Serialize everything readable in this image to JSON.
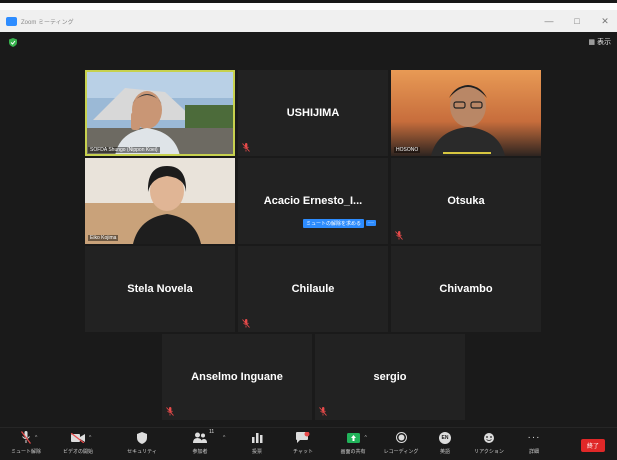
{
  "window": {
    "title": "Zoom ミーティング",
    "controls": [
      "—",
      "□",
      "✕"
    ]
  },
  "top": {
    "view_label": "表示",
    "view_icon": "grid-icon",
    "security_icon": "shield-icon"
  },
  "colors": {
    "background": "#1a1a1a",
    "tile": "#222222",
    "active_speaker_border": "#c7d14e",
    "accent": "#2d8cff",
    "end_button": "#e02828",
    "muted_icon": "#e84a4a"
  },
  "participants": [
    {
      "tile_label": "",
      "name_tag": "SOFDA Shungo (Nippon Koei)",
      "video": true,
      "active_speaker": true,
      "muted": false
    },
    {
      "tile_label": "USHIJIMA",
      "name_tag": "",
      "video": false,
      "muted": true
    },
    {
      "tile_label": "",
      "name_tag": "HOSONO",
      "video": true,
      "muted": false
    },
    {
      "tile_label": "",
      "name_tag": "Eiko Kojima",
      "video": true,
      "muted": false
    },
    {
      "tile_label": "Acacio  Ernesto_I...",
      "name_tag": "",
      "video": false,
      "muted": false
    },
    {
      "tile_label": "Otsuka",
      "name_tag": "",
      "video": false,
      "muted": true
    },
    {
      "tile_label": "Stela Novela",
      "name_tag": "",
      "video": false,
      "muted": false
    },
    {
      "tile_label": "Chilaule",
      "name_tag": "",
      "video": false,
      "muted": true
    },
    {
      "tile_label": "Chivambo",
      "name_tag": "",
      "video": false,
      "muted": false
    },
    {
      "tile_label": "Anselmo Inguane",
      "name_tag": "",
      "video": false,
      "muted": true
    },
    {
      "tile_label": "sergio",
      "name_tag": "",
      "video": false,
      "muted": true
    }
  ],
  "unmute_request": {
    "label": "ミュートの解除を求める",
    "more": "···"
  },
  "toolbar": {
    "items": [
      {
        "label": "ミュート解除",
        "icon": "microphone-muted-icon"
      },
      {
        "label": "ビデオの開始",
        "icon": "video-off-icon"
      },
      {
        "label": "セキュリティ",
        "icon": "shield-icon"
      },
      {
        "label": "参加者",
        "icon": "participants-icon",
        "badge": "11"
      },
      {
        "label": "投票",
        "icon": "poll-icon"
      },
      {
        "label": "チャット",
        "icon": "chat-icon"
      },
      {
        "label": "画面の共有",
        "icon": "share-screen-icon"
      },
      {
        "label": "レコーディング",
        "icon": "record-icon"
      },
      {
        "label": "英語",
        "icon": "language-icon",
        "icon_text": "EN"
      },
      {
        "label": "リアクション",
        "icon": "reaction-icon"
      },
      {
        "label": "詳細",
        "icon": "more-icon",
        "icon_text": "···"
      }
    ],
    "end_label": "終了"
  }
}
